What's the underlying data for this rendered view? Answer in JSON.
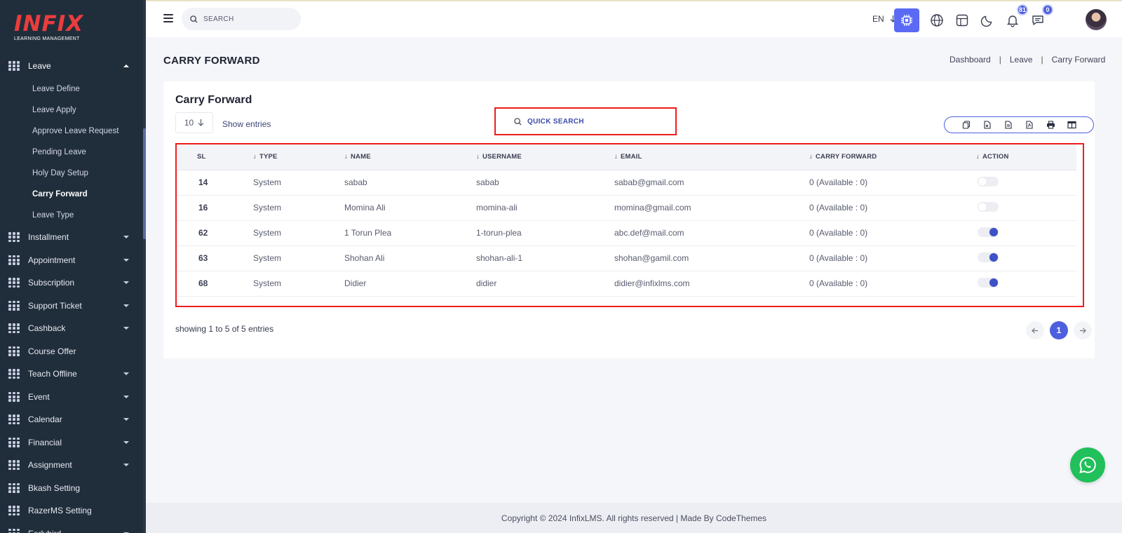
{
  "brand": {
    "name": "INFIX",
    "tagline": "LEARNING MANAGEMENT"
  },
  "sidebar": {
    "open_section": {
      "label": "Leave",
      "icon": "grid-icon"
    },
    "sub_items": [
      {
        "label": "Leave Define"
      },
      {
        "label": "Leave Apply"
      },
      {
        "label": "Approve Leave Request"
      },
      {
        "label": "Pending Leave"
      },
      {
        "label": "Holy Day Setup"
      },
      {
        "label": "Carry Forward",
        "active": true
      },
      {
        "label": "Leave Type"
      }
    ],
    "items": [
      {
        "label": "Installment",
        "has_children": true
      },
      {
        "label": "Appointment",
        "has_children": true
      },
      {
        "label": "Subscription",
        "has_children": true
      },
      {
        "label": "Support Ticket",
        "has_children": true
      },
      {
        "label": "Cashback",
        "has_children": true
      },
      {
        "label": "Course Offer",
        "has_children": false
      },
      {
        "label": "Teach Offline",
        "has_children": true
      },
      {
        "label": "Event",
        "has_children": true
      },
      {
        "label": "Calendar",
        "has_children": true
      },
      {
        "label": "Financial",
        "has_children": true
      },
      {
        "label": "Assignment",
        "has_children": true
      },
      {
        "label": "Bkash Setting",
        "has_children": false
      },
      {
        "label": "RazerMS Setting",
        "has_children": false
      },
      {
        "label": "Earlybird",
        "has_children": true
      }
    ]
  },
  "header": {
    "search_placeholder": "SEARCH",
    "language": "EN",
    "notifications_count": "81",
    "messages_count": "0",
    "icons": [
      "menu-icon",
      "search-icon",
      "chip-icon",
      "globe-icon",
      "layout-icon",
      "moon-icon",
      "bell-icon",
      "chat-icon"
    ]
  },
  "page": {
    "title": "CARRY FORWARD",
    "breadcrumb": [
      "Dashboard",
      "Leave",
      "Carry Forward"
    ]
  },
  "card": {
    "title": "Carry Forward",
    "entries_value": "10",
    "show_entries_label": "Show entries",
    "quick_search_placeholder": "QUICK SEARCH",
    "export_icons": [
      "copy-icon",
      "excel-icon",
      "csv-icon",
      "pdf-icon",
      "print-icon",
      "columns-icon"
    ],
    "table": {
      "headers": [
        "SL",
        "TYPE",
        "NAME",
        "USERNAME",
        "EMAIL",
        "CARRY FORWARD",
        "ACTION"
      ],
      "rows": [
        {
          "sl": "14",
          "type": "System",
          "name": "sabab",
          "username": "sabab",
          "email": "sabab@gmail.com",
          "carry": "0 (Available : 0)",
          "active": false
        },
        {
          "sl": "16",
          "type": "System",
          "name": "Momina Ali",
          "username": "momina-ali",
          "email": "momina@gmail.com",
          "carry": "0 (Available : 0)",
          "active": false
        },
        {
          "sl": "62",
          "type": "System",
          "name": "1 Torun Plea",
          "username": "1-torun-plea",
          "email": "abc.def@mail.com",
          "carry": "0 (Available : 0)",
          "active": true
        },
        {
          "sl": "63",
          "type": "System",
          "name": "Shohan Ali",
          "username": "shohan-ali-1",
          "email": "shohan@gamil.com",
          "carry": "0 (Available : 0)",
          "active": true
        },
        {
          "sl": "68",
          "type": "System",
          "name": "Didier",
          "username": "didier",
          "email": "didier@infixlms.com",
          "carry": "0 (Available : 0)",
          "active": true
        }
      ]
    },
    "showing_text": "showing 1 to 5 of 5 entries",
    "current_page": "1"
  },
  "footer": {
    "text": "Copyright © 2024 InfixLMS. All rights reserved | Made By CodeThemes"
  },
  "colors": {
    "sidebar_bg": "#202e3b",
    "accent": "#4c5fde",
    "highlight_red": "#ee1d1d",
    "whatsapp": "#21c05b",
    "brand_red": "#ea3d3d"
  }
}
